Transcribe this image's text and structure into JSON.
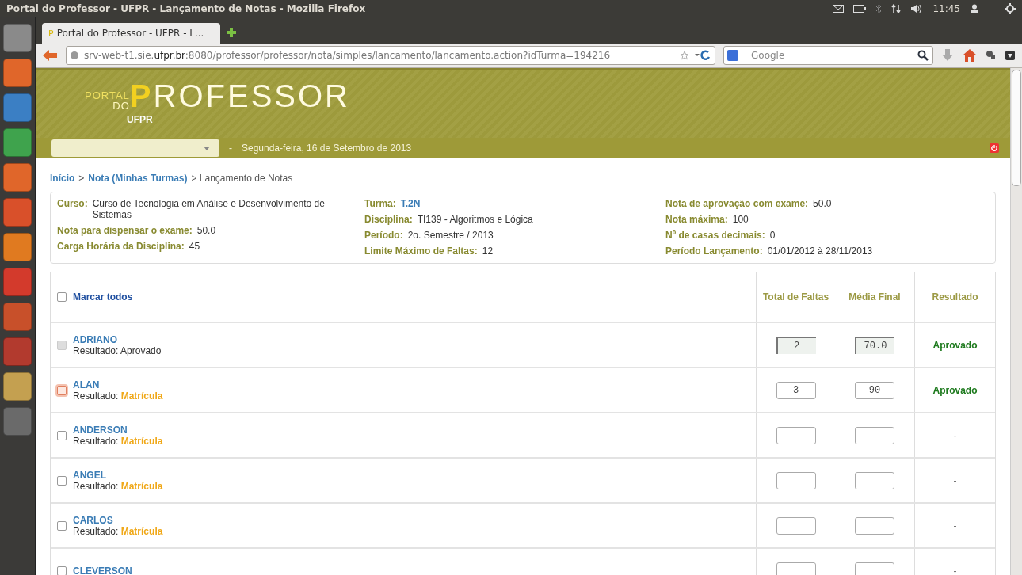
{
  "panel": {
    "title": "Portal do Professor - UFPR - Lançamento de Notas - Mozilla Firefox",
    "time": "11:45"
  },
  "launcher": [
    {
      "color": "#8a8a8a"
    },
    {
      "color": "#e0662a"
    },
    {
      "color": "#3b7fc4"
    },
    {
      "color": "#3fa34d"
    },
    {
      "color": "#e0662a"
    },
    {
      "color": "#d9502a"
    },
    {
      "color": "#e07a20"
    },
    {
      "color": "#d33a2c"
    },
    {
      "color": "#c8502a"
    },
    {
      "color": "#b23a2e"
    },
    {
      "color": "#c4a050"
    },
    {
      "color": "#6a6a6a"
    }
  ],
  "browser": {
    "favicon": "P",
    "tab": "Portal do Professor - UFPR - L...",
    "url_host": "srv-web-t1.sie.",
    "url_domain": "ufpr.br",
    "url_rest": ":8080/professor/professor/nota/simples/lancamento/lancamento.action?idTurma=194216",
    "search_placeholder": "Google"
  },
  "header": {
    "logo_small_1": "PORTAL",
    "logo_small_2": "DO",
    "logo_big_initial": "P",
    "logo_big_rest": "ROFESSOR",
    "subtitle": "UFPR",
    "date": "Segunda-feira, 16 de Setembro de 2013",
    "bullet": "-"
  },
  "breadcrumb": [
    {
      "text": "Início",
      "link": true
    },
    {
      "text": ">",
      "link": false
    },
    {
      "text": "Nota (Minhas Turmas)",
      "link": true
    },
    {
      "text": "> Lançamento de Notas",
      "link": false
    }
  ],
  "info": [
    [
      {
        "label": "Curso:",
        "value": "Curso de Tecnologia em Análise e Desenvolvimento de Sistemas",
        "link": false
      },
      {
        "label": "Nota para dispensar o exame:",
        "value": "50.0",
        "link": false
      },
      {
        "label": "Carga Horária da Disciplina:",
        "value": "45",
        "link": false
      }
    ],
    [
      {
        "label": "Turma:",
        "value": "T.2N",
        "link": true
      },
      {
        "label": "Disciplina:",
        "value": "TI139 - Algoritmos e Lógica",
        "link": false
      },
      {
        "label": "Período:",
        "value": "2o. Semestre / 2013",
        "link": false
      },
      {
        "label": "Limite Máximo de Faltas:",
        "value": "12",
        "link": false
      }
    ],
    [
      {
        "label": "Nota de aprovação com exame:",
        "value": "50.0",
        "link": false
      },
      {
        "label": "Nota máxima:",
        "value": "100",
        "link": false
      },
      {
        "label": "Nº de casas decimais:",
        "value": "0",
        "link": false
      },
      {
        "label": "Período Lançamento:",
        "value": "01/01/2012 à 28/11/2013",
        "link": false
      }
    ]
  ],
  "table": {
    "select_all": {
      "label": "Marcar todos",
      "checked": false
    },
    "columns": [
      "Total de Faltas",
      "Média Final",
      "Resultado"
    ],
    "rows": [
      {
        "name": "ADRIANO",
        "result_label": "Resultado:",
        "status": "Aprovado",
        "status_highlighted": false,
        "checked": false,
        "disabled": true,
        "focused": false,
        "faltas": "2",
        "media": "70.0",
        "readonly": true,
        "resultado": "Aprovado",
        "resultado_approved": true
      },
      {
        "name": "ALAN",
        "result_label": "Resultado:",
        "status": "Matrícula",
        "status_highlighted": true,
        "checked": false,
        "disabled": false,
        "focused": true,
        "faltas": "3",
        "media": "90",
        "readonly": false,
        "resultado": "Aprovado",
        "resultado_approved": true
      },
      {
        "name": "ANDERSON",
        "result_label": "Resultado:",
        "status": "Matrícula",
        "status_highlighted": true,
        "checked": false,
        "disabled": false,
        "focused": false,
        "faltas": "",
        "media": "",
        "readonly": false,
        "resultado": "-",
        "resultado_approved": false
      },
      {
        "name": "ANGEL",
        "result_label": "Resultado:",
        "status": "Matrícula",
        "status_highlighted": true,
        "checked": false,
        "disabled": false,
        "focused": false,
        "faltas": "",
        "media": "",
        "readonly": false,
        "resultado": "-",
        "resultado_approved": false
      },
      {
        "name": "CARLOS",
        "result_label": "Resultado:",
        "status": "Matrícula",
        "status_highlighted": true,
        "checked": false,
        "disabled": false,
        "focused": false,
        "faltas": "",
        "media": "",
        "readonly": false,
        "resultado": "-",
        "resultado_approved": false
      },
      {
        "name": "CLEVERSON",
        "checked": false,
        "disabled": false,
        "focused": false,
        "faltas": "",
        "media": "",
        "readonly": false,
        "resultado": "-",
        "resultado_approved": false
      }
    ]
  }
}
